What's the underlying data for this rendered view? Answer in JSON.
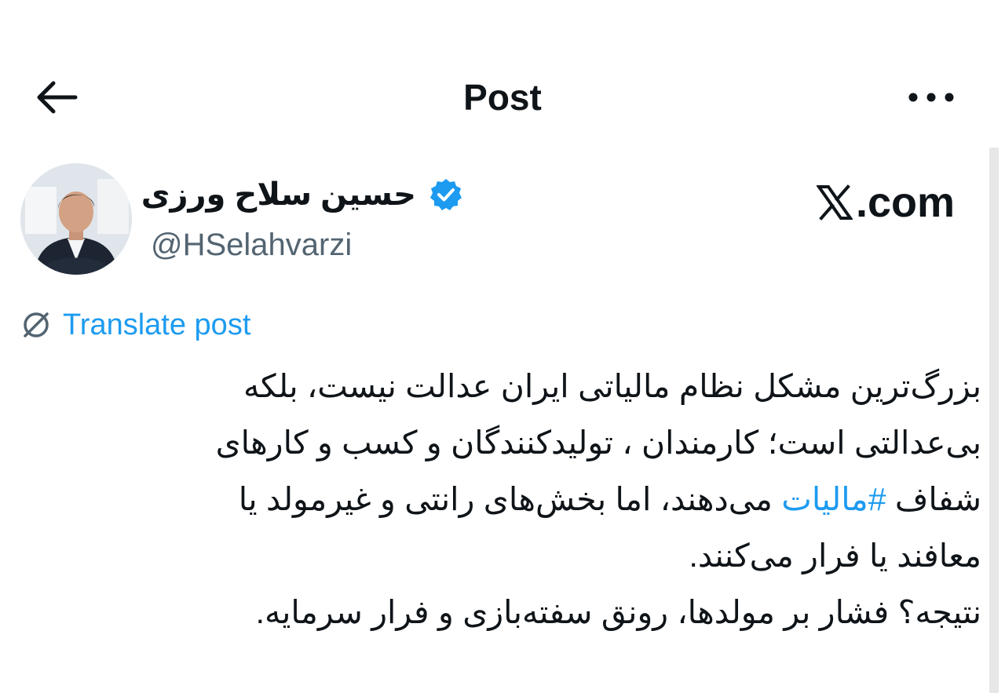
{
  "header": {
    "title": "Post",
    "back_icon": "arrow-left-icon",
    "more_icon": "more-horizontal-icon"
  },
  "author": {
    "display_name": "حسین سلاح ورزی",
    "handle": "@HSelahvarzi",
    "verified": true,
    "verified_color": "#1d9bf0"
  },
  "watermark": {
    "domain": ".com",
    "logo_icon": "x-logo-icon"
  },
  "translate": {
    "label": "Translate post",
    "icon": "translate-globe-icon"
  },
  "post": {
    "lines": [
      "بزرگ‌ترین مشکل نظام مالیاتی ایران عدالت نیست، بلکه",
      "بی‌عدالتی است؛ کارمندان ، تولیدکنندگان و کسب و کارهای",
      "می‌دهند، اما بخش‌های رانتی و غیرمولد یا",
      "معافند یا فرار می‌کنند.",
      "نتیجه؟ فشار بر مولدها، رونق سفته‌بازی و فرار سرمایه."
    ],
    "line3_prefix": "شفاف",
    "hashtag": "#مالیات",
    "link_color": "#1d9bf0"
  }
}
